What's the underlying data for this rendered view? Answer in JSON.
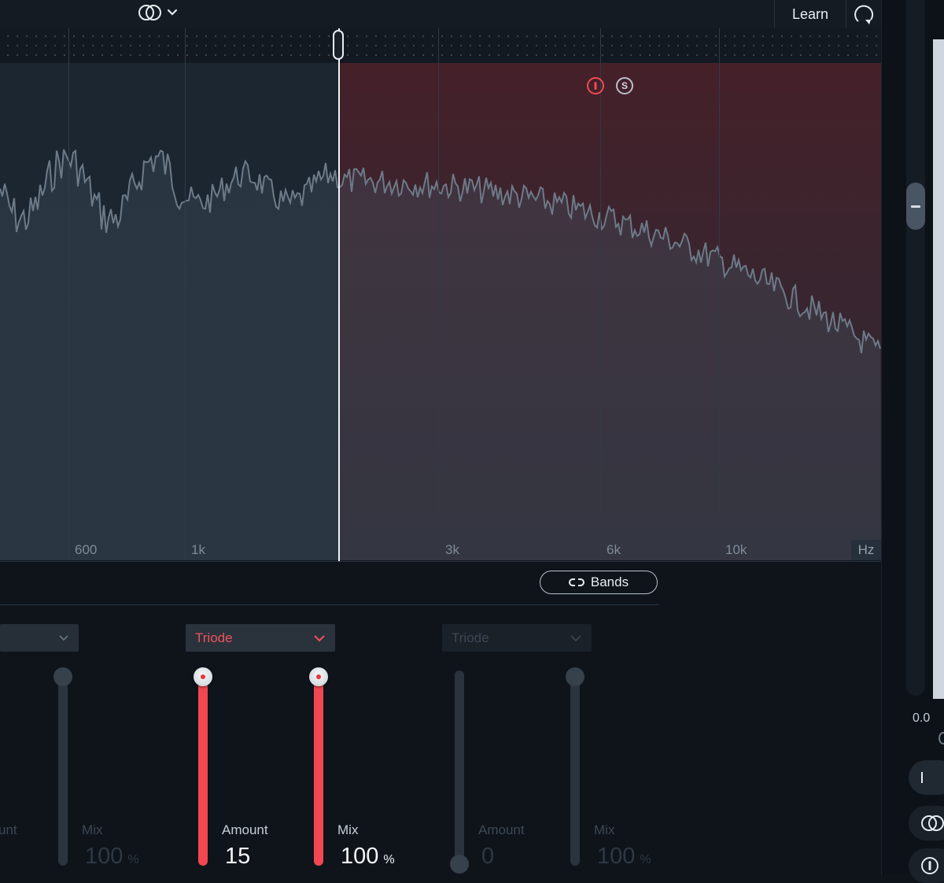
{
  "toolbar": {
    "link_mode_icon": "stereo-link-icon",
    "learn_label": "Learn",
    "refresh_icon": "refresh-icon"
  },
  "spectrum": {
    "freq_labels": [
      "600",
      "1k",
      "3k",
      "6k",
      "10k"
    ],
    "unit_label": "Hz",
    "band_bypass_icon": "power-icon",
    "band_solo_label": "S",
    "colors": {
      "active_band": "#452029",
      "accent": "#f2474f",
      "inactive_band": "#1b2630"
    }
  },
  "bands_button": {
    "label": "Bands",
    "icon": "link-icon"
  },
  "modules": [
    {
      "id": "left",
      "mode": "",
      "amount_label": "unt",
      "mix_label": "Mix",
      "mix_value": "100",
      "mix_unit": "%",
      "mix_level": 1.0
    },
    {
      "id": "center",
      "mode": "Triode",
      "amount_label": "Amount",
      "amount_value": "15",
      "amount_level": 1.0,
      "mix_label": "Mix",
      "mix_value": "100",
      "mix_unit": "%",
      "mix_level": 1.0
    },
    {
      "id": "right",
      "mode": "Triode",
      "amount_label": "Amount",
      "amount_value": "0",
      "amount_level": 0.0,
      "mix_label": "Mix",
      "mix_value": "100",
      "mix_unit": "%",
      "mix_level": 1.0
    }
  ],
  "output": {
    "gain_value": "0.0"
  }
}
